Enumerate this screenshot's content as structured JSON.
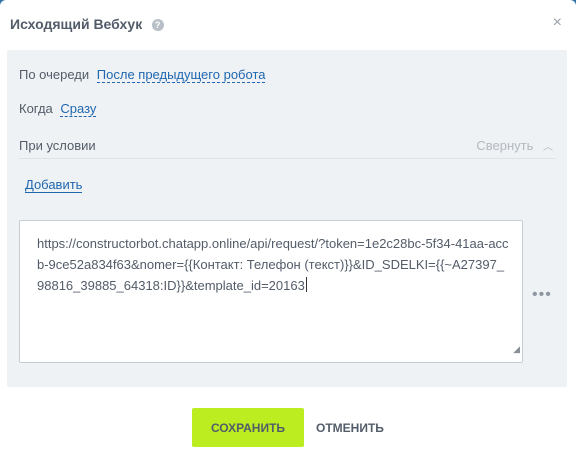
{
  "dialog": {
    "title": "Исходящий Вебхук",
    "help_icon": "?",
    "close_icon": "×"
  },
  "settings": {
    "queue_label": "По очереди",
    "queue_value": "После предыдущего робота",
    "when_label": "Когда",
    "when_value": "Сразу",
    "condition_label": "При условии",
    "collapse_label": "Свернуть",
    "add_label": "Добавить"
  },
  "url_field": {
    "value": "https://constructorbot.chatapp.online/api/request/?token=1e2c28bc-5f34-41aa-accb-9ce52a834f63&nomer={{Контакт: Телефон (текст)}}&ID_SDELKI={{~A27397_98816_39885_64318:ID}}&template_id=20163"
  },
  "more_icon": "•••",
  "buttons": {
    "save": "СОХРАНИТЬ",
    "cancel": "ОТМЕНИТЬ"
  },
  "icons": {
    "help": "help-icon",
    "close": "close-icon",
    "chevron": "chevron-up-icon",
    "more": "more-icon"
  },
  "colors": {
    "accent_link": "#2067b0",
    "save_button": "#bbed21",
    "panel_bg": "#eef2f4"
  }
}
